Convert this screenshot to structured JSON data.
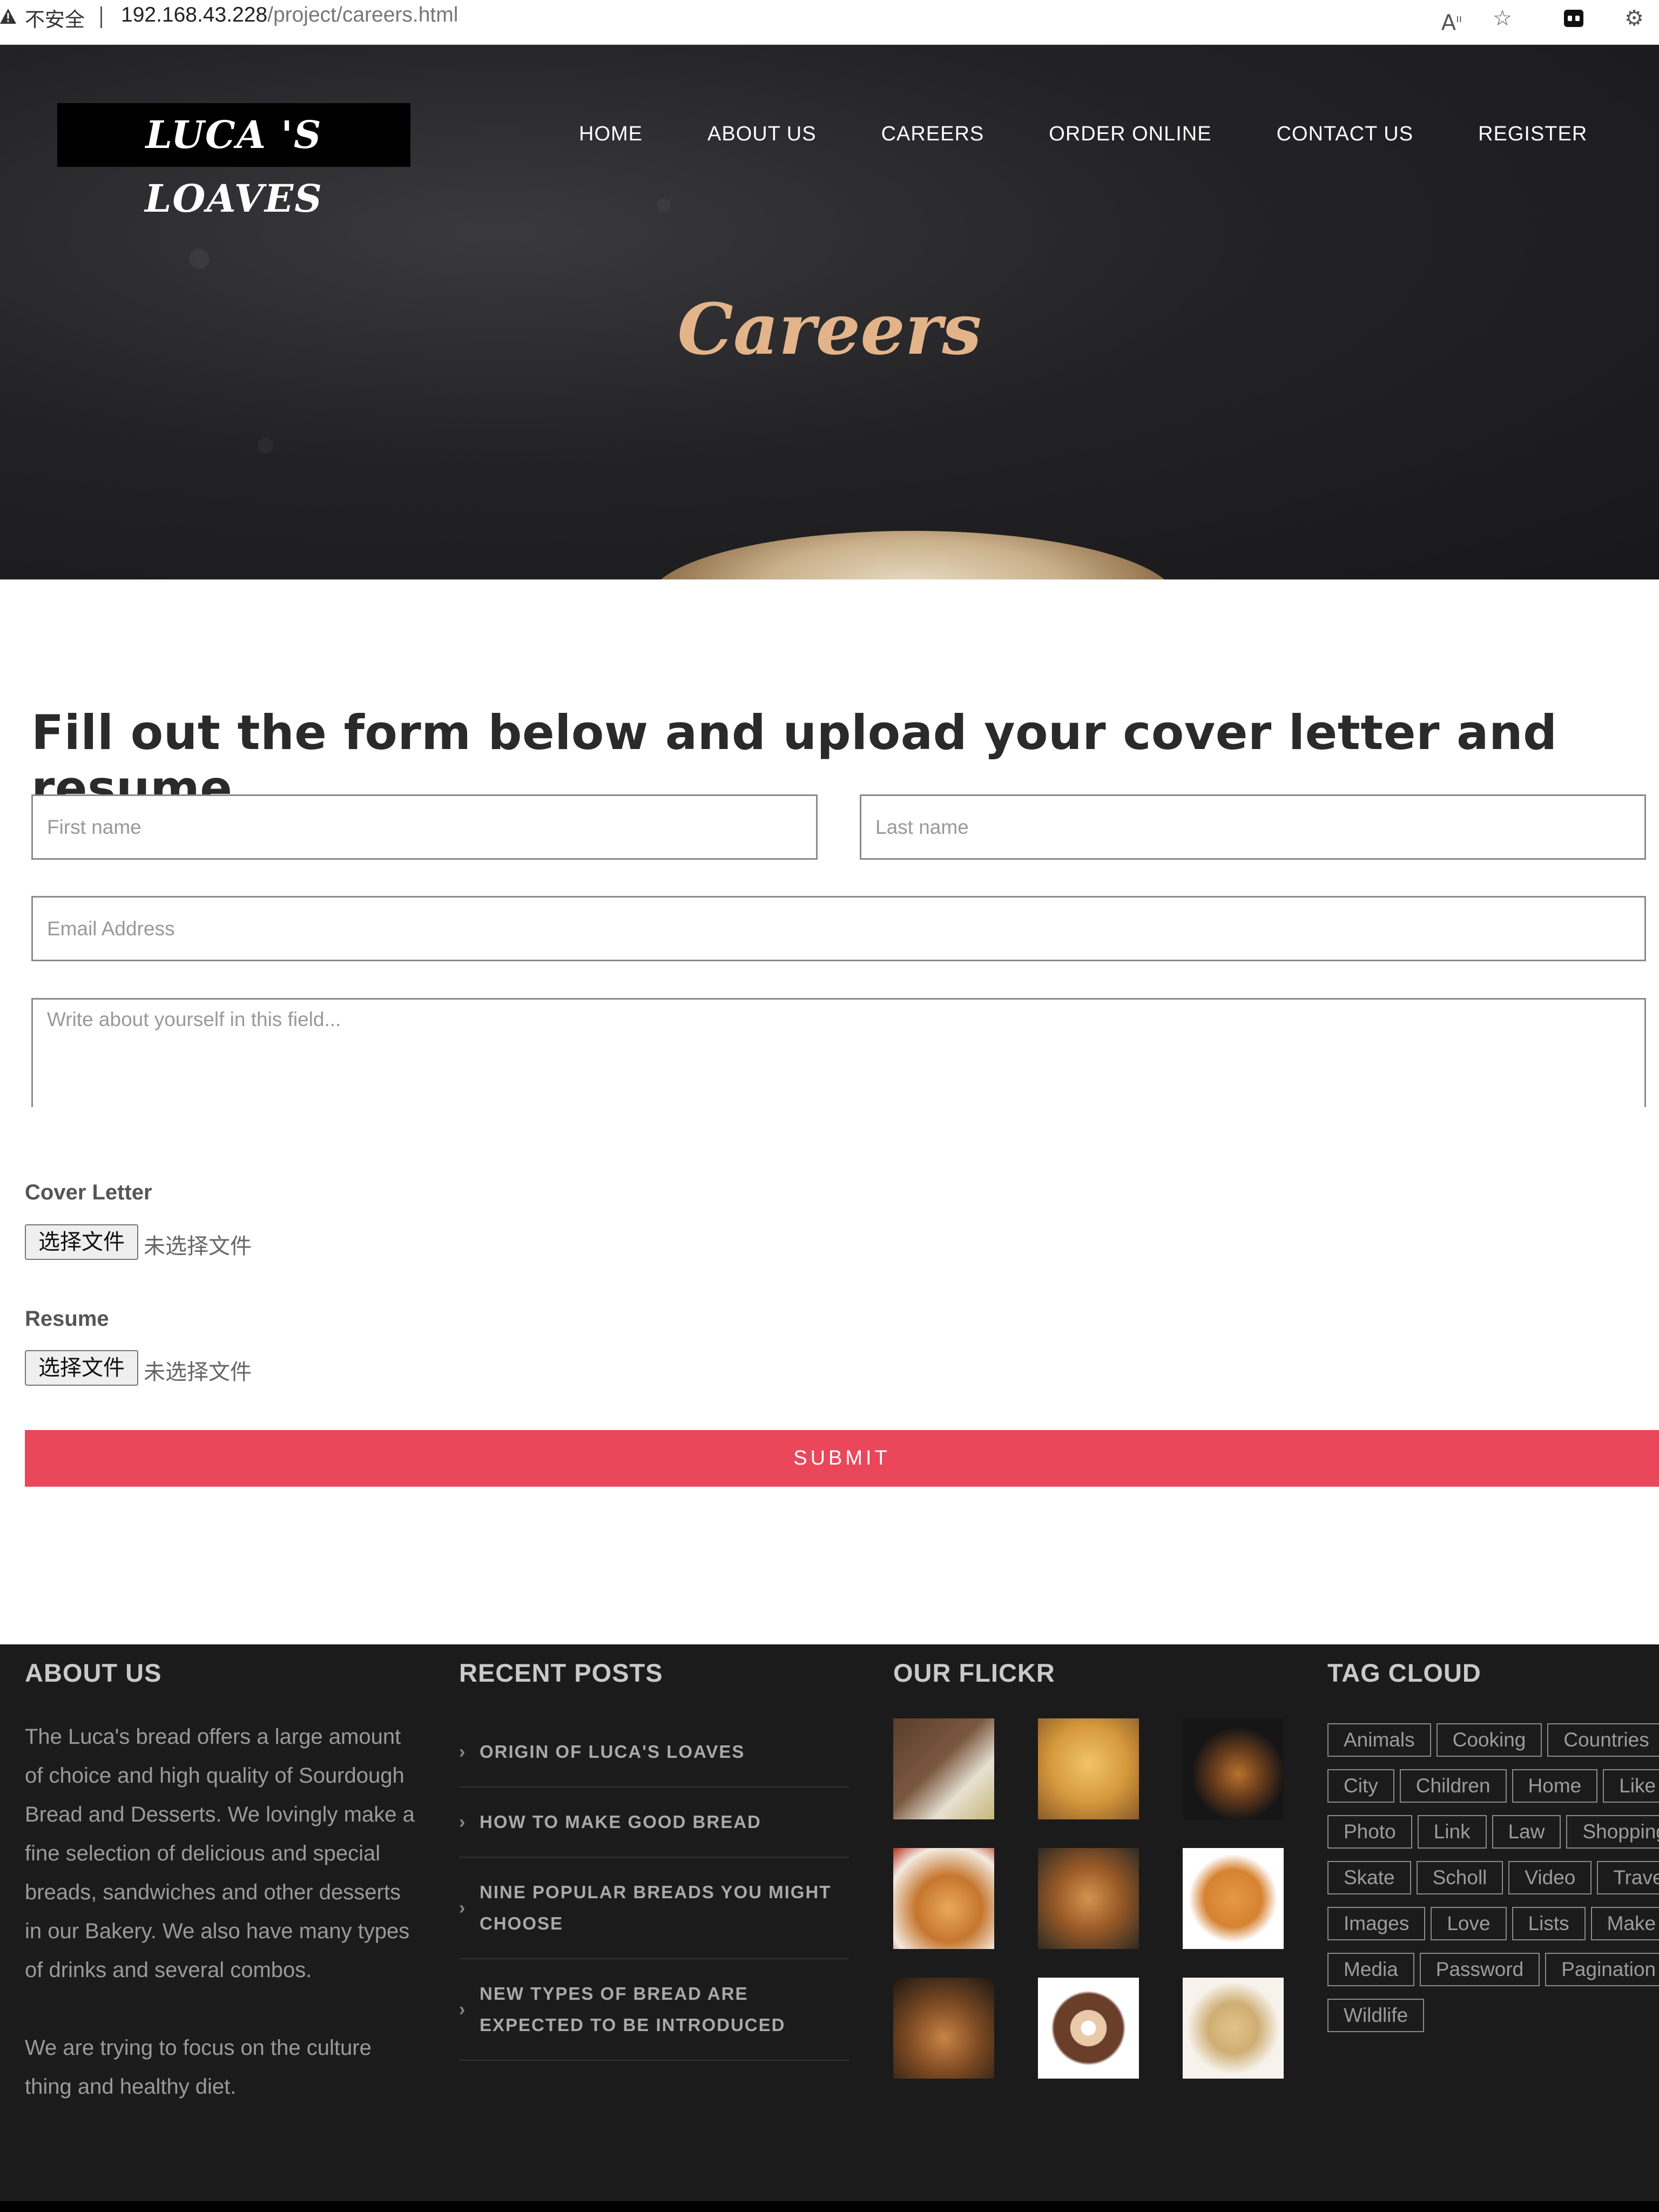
{
  "browser": {
    "not_secure": "不安全",
    "url_host": "192.168.43.228",
    "url_path": "/project/careers.html"
  },
  "header": {
    "logo": "LUCA 'S LOAVES",
    "nav": [
      "HOME",
      "ABOUT US",
      "CAREERS",
      "ORDER ONLINE",
      "CONTACT US",
      "REGISTER"
    ],
    "page_title": "Careers"
  },
  "form": {
    "heading": "Fill out the form below and upload your cover letter and resume",
    "first_name_placeholder": "First name",
    "last_name_placeholder": "Last name",
    "email_placeholder": "Email Address",
    "about_placeholder": "Write about yourself in this field...",
    "cover_letter_label": "Cover Letter",
    "resume_label": "Resume",
    "choose_file_label": "选择文件",
    "no_file_text": "未选择文件",
    "submit_label": "SUBMIT",
    "submit_color": "#ea475b"
  },
  "footer": {
    "about": {
      "heading": "ABOUT US",
      "paragraph1": "The Luca's bread offers a large amount of choice and high quality of Sourdough Bread and Desserts. We lovingly make a fine selection of delicious and special breads, sandwiches and other desserts in our Bakery. We also have many types of drinks and several combos.",
      "paragraph2": "We are trying to focus on the culture thing and healthy diet."
    },
    "recent_posts": {
      "heading": "RECENT POSTS",
      "items": [
        "ORIGIN OF LUCA'S LOAVES",
        "HOW TO MAKE GOOD BREAD",
        "NINE POPULAR BREADS YOU MIGHT CHOOSE",
        "NEW TYPES OF BREAD ARE EXPECTED TO BE INTRODUCED"
      ]
    },
    "flickr": {
      "heading": "OUR FLICKR",
      "photos": [
        "bread-photo",
        "croissant-photo",
        "croissant-photo",
        "croissant-photo",
        "bread-photo",
        "bun-photo",
        "bread-photo",
        "donut-photo",
        "bread-photo"
      ]
    },
    "tag_cloud": {
      "heading": "TAG CLOUD",
      "rows": [
        [
          "Animals",
          "Cooking",
          "Countries"
        ],
        [
          "City",
          "Children",
          "Home",
          "Like"
        ],
        [
          "Photo",
          "Link",
          "Law",
          "Shopping"
        ],
        [
          "Skate",
          "Scholl",
          "Video",
          "Travel"
        ],
        [
          "Images",
          "Love",
          "Lists",
          "Make"
        ],
        [
          "Media",
          "Password",
          "Pagination"
        ],
        [
          "Wildlife"
        ]
      ]
    }
  }
}
